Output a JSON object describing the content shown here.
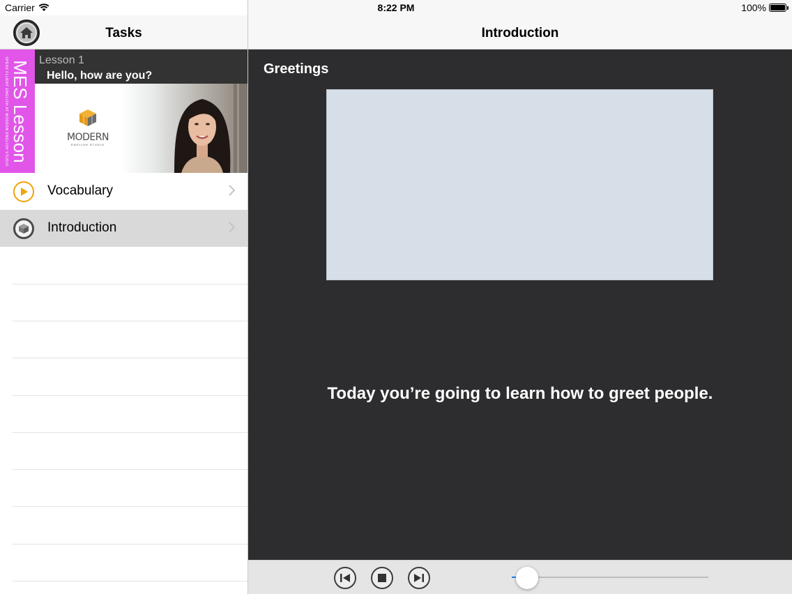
{
  "status_bar": {
    "carrier": "Carrier",
    "time": "8:22 PM",
    "battery_percent": "100%",
    "battery_level": 1.0
  },
  "sidebar": {
    "title": "Tasks",
    "lesson": {
      "tab_title": "MES Lesson",
      "tab_subtitle": "SPEAK FLUENT ENGLISH AT MODERN ENGLISH STUDIO",
      "number": "Lesson 1",
      "title": "Hello, how are you?",
      "logo_text": "MODERN",
      "logo_subtext": "ENGLISH STUDIO"
    },
    "tasks": [
      {
        "label": "Vocabulary",
        "icon": "play-circle-icon",
        "icon_color": "#f0a30a",
        "selected": false
      },
      {
        "label": "Introduction",
        "icon": "cube-icon",
        "icon_color": "#555555",
        "selected": true
      }
    ]
  },
  "main": {
    "title": "Introduction",
    "section_heading": "Greetings",
    "caption": "Today you’re going to learn how to greet people.",
    "slider_value": 0.03
  },
  "colors": {
    "lesson_tab": "#e155e8",
    "content_background": "#2d2d2f",
    "media_placeholder": "#d6dee8",
    "slider_accent": "#1e7cf0"
  }
}
